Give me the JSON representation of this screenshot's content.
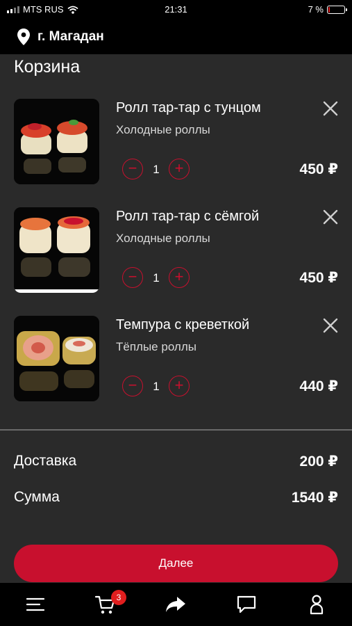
{
  "status_bar": {
    "carrier": "MTS RUS",
    "time": "21:31",
    "battery_text": "7 %",
    "battery_level": 0.07
  },
  "header": {
    "location_icon": "location-pin-icon",
    "city": "г. Магадан"
  },
  "page": {
    "title": "Корзина"
  },
  "cart": {
    "items": [
      {
        "name": "Ролл тар-тар с тунцом",
        "category": "Холодные роллы",
        "quantity": "1",
        "price": "450 ₽",
        "image": "tuna-roll-photo"
      },
      {
        "name": "Ролл тар-тар с сёмгой",
        "category": "Холодные роллы",
        "quantity": "1",
        "price": "450 ₽",
        "image": "salmon-roll-photo"
      },
      {
        "name": "Темпура с креветкой",
        "category": "Тёплые роллы",
        "quantity": "1",
        "price": "440 ₽",
        "image": "tempura-shrimp-photo"
      }
    ],
    "minus_symbol": "−",
    "plus_symbol": "+"
  },
  "summary": {
    "delivery_label": "Доставка",
    "delivery_value": "200 ₽",
    "total_label": "Сумма",
    "total_value": "1540 ₽"
  },
  "actions": {
    "next_label": "Далее"
  },
  "tabbar": {
    "cart_badge": "3",
    "icons": [
      "menu-icon",
      "cart-icon",
      "share-icon",
      "chat-icon",
      "profile-icon"
    ]
  },
  "colors": {
    "accent": "#c8102e",
    "background": "#2a2a2a",
    "bar": "#000000"
  }
}
